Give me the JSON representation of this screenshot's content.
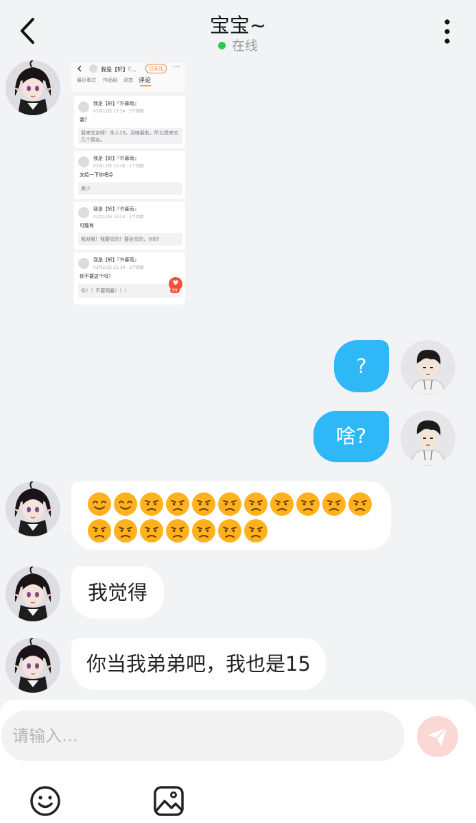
{
  "header": {
    "title": "宝宝~",
    "status": "在线"
  },
  "shot": {
    "top_name": "我是【轩】『...",
    "follow": "已关注",
    "tabs": [
      "最近看过",
      "作品组",
      "动态",
      "评论"
    ],
    "cards": [
      {
        "name": "我是【轩】『许暮雨』",
        "meta": "03月12日 13:34 · 3个回复",
        "text": "我？",
        "reply": "我来交友呀！本人15，没啥朋友，所以想来交几个朋友。"
      },
      {
        "name": "我是【轩】『许暮雨』",
        "meta": "03月11日 10:36 · 1个回复",
        "text": "交给一下你吧😛",
        "reply": "美少"
      },
      {
        "name": "我是【轩】『许暮雨』",
        "meta": "03月11日 10:24 · 1个回复",
        "text": "可能有",
        "reply": "我对我！我要交的！要会交的，对的！"
      },
      {
        "name": "我是【轩】『许暮雨』",
        "meta": "02月23日 21:34 · 1个回复",
        "text": "你不要这个吗？",
        "reply": "😟！！不要网暴！！！",
        "badge": "99"
      }
    ]
  },
  "messages": {
    "m1": "?",
    "m2": "啥?",
    "m4": "我觉得",
    "m5": "你当我弟弟吧，我也是15"
  },
  "emoji_row1": [
    "smile",
    "smile",
    "frown",
    "frown",
    "frown",
    "frown",
    "frown",
    "frown",
    "frown",
    "frown",
    "frown"
  ],
  "emoji_row2": [
    "frown",
    "frown",
    "frown",
    "frown",
    "frown",
    "frown",
    "frown"
  ],
  "composer": {
    "placeholder": "请输入…"
  },
  "colors": {
    "accent": "#2fb8f8",
    "online": "#2cc84d",
    "send_disabled": "#fcd8d4",
    "emoji": "#ffb21e"
  },
  "icons": {
    "back": "chevron-left-icon",
    "more": "more-vertical-icon",
    "send": "send-icon",
    "emoji": "emoji-icon",
    "image": "image-icon"
  }
}
